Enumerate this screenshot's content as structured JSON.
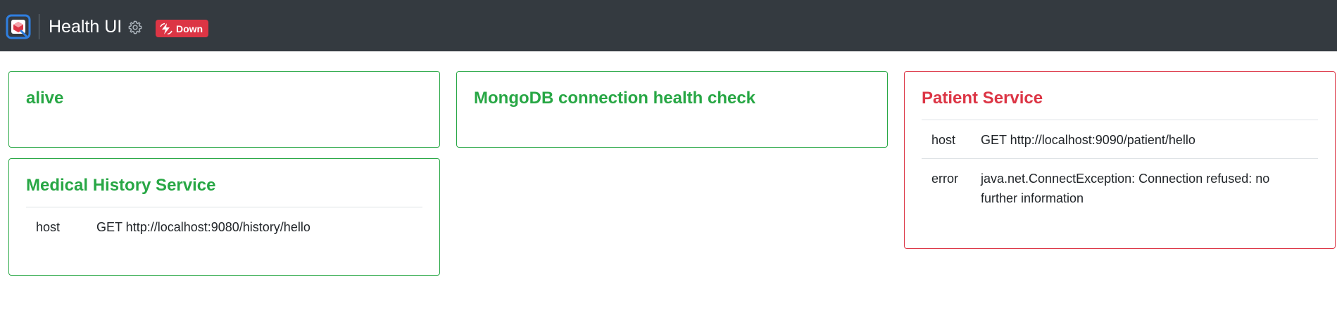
{
  "app": {
    "title": "Health UI",
    "status": "Down",
    "colors": {
      "navbar": "#343a40",
      "up": "#28a745",
      "down": "#dc3545"
    },
    "icons": [
      "app-logo-icon",
      "gear-icon",
      "lightning-icon"
    ]
  },
  "checks": [
    {
      "name": "alive",
      "status": "up",
      "data": []
    },
    {
      "name": "MongoDB connection health check",
      "status": "up",
      "data": []
    },
    {
      "name": "Patient Service",
      "status": "down",
      "data": [
        {
          "key": "host",
          "value": "GET http://localhost:9090/patient/hello"
        },
        {
          "key": "error",
          "value": "java.net.ConnectException: Connection refused: no further information"
        }
      ]
    },
    {
      "name": "Medical History Service",
      "status": "up",
      "data": [
        {
          "key": "host",
          "value": "GET http://localhost:9080/history/hello"
        }
      ]
    }
  ]
}
